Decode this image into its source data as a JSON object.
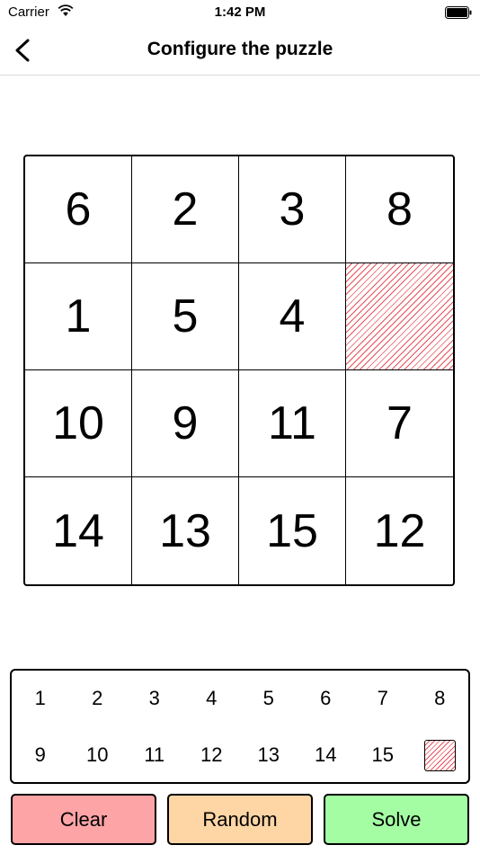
{
  "status_bar": {
    "carrier": "Carrier",
    "time": "1:42 PM",
    "wifi_icon": "wifi-icon",
    "battery_icon": "battery-icon"
  },
  "nav": {
    "title": "Configure the puzzle",
    "back_icon": "chevron-left-icon"
  },
  "board": {
    "tiles": [
      [
        "6",
        "2",
        "3",
        "8"
      ],
      [
        "1",
        "5",
        "4",
        ""
      ],
      [
        "10",
        "9",
        "11",
        "7"
      ],
      [
        "14",
        "13",
        "15",
        "12"
      ]
    ],
    "empty_pattern_color": "#e8505b"
  },
  "palette": {
    "rows": [
      [
        "1",
        "2",
        "3",
        "4",
        "5",
        "6",
        "7",
        "8"
      ],
      [
        "9",
        "10",
        "11",
        "12",
        "13",
        "14",
        "15",
        ""
      ]
    ]
  },
  "actions": {
    "clear": {
      "label": "Clear",
      "color": "#fda4a7"
    },
    "random": {
      "label": "Random",
      "color": "#fed6a6"
    },
    "solve": {
      "label": "Solve",
      "color": "#a4fca3"
    }
  }
}
